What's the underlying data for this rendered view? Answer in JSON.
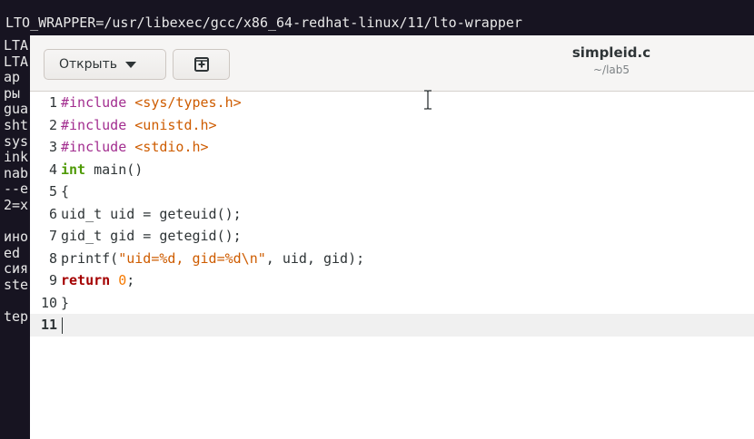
{
  "terminal": {
    "top_line": "LTO_WRAPPER=/usr/libexec/gcc/x86_64-redhat-linux/11/lto-wrapper",
    "left_fragments": [
      "LTA",
      "LTA",
      "ap",
      "ры",
      "gua",
      "sht",
      "sys",
      "ink",
      "nab",
      "--e",
      "2=x",
      "",
      "ино",
      "ed",
      "сия",
      "ste",
      "",
      "tep"
    ]
  },
  "headerbar": {
    "open_label": "Открыть",
    "new_tab_icon": "new-document-icon",
    "title": "simpleid.c",
    "subtitle": "~/lab5"
  },
  "editor": {
    "current_line": 11,
    "lines": [
      {
        "num": "1",
        "segments": [
          {
            "cls": "pp",
            "t": "#include "
          },
          {
            "cls": "str",
            "t": "<sys/types.h>"
          }
        ]
      },
      {
        "num": "2",
        "segments": [
          {
            "cls": "pp",
            "t": "#include "
          },
          {
            "cls": "str",
            "t": "<unistd.h>"
          }
        ]
      },
      {
        "num": "3",
        "segments": [
          {
            "cls": "pp",
            "t": "#include "
          },
          {
            "cls": "str",
            "t": "<stdio.h>"
          }
        ]
      },
      {
        "num": "4",
        "segments": [
          {
            "cls": "kw-type",
            "t": "int"
          },
          {
            "cls": "",
            "t": " main()"
          }
        ]
      },
      {
        "num": "5",
        "segments": [
          {
            "cls": "",
            "t": "{"
          }
        ]
      },
      {
        "num": "6",
        "segments": [
          {
            "cls": "",
            "t": "uid_t uid = geteuid();"
          }
        ]
      },
      {
        "num": "7",
        "segments": [
          {
            "cls": "",
            "t": "gid_t gid = getegid();"
          }
        ]
      },
      {
        "num": "8",
        "segments": [
          {
            "cls": "",
            "t": "printf("
          },
          {
            "cls": "str",
            "t": "\"uid=%d, gid=%d\\n\""
          },
          {
            "cls": "",
            "t": ", uid, gid);"
          }
        ]
      },
      {
        "num": "9",
        "segments": [
          {
            "cls": "kw",
            "t": "return"
          },
          {
            "cls": "",
            "t": " "
          },
          {
            "cls": "num",
            "t": "0"
          },
          {
            "cls": "",
            "t": ";"
          }
        ]
      },
      {
        "num": "10",
        "segments": [
          {
            "cls": "",
            "t": "}"
          }
        ]
      },
      {
        "num": "11",
        "segments": []
      }
    ]
  }
}
